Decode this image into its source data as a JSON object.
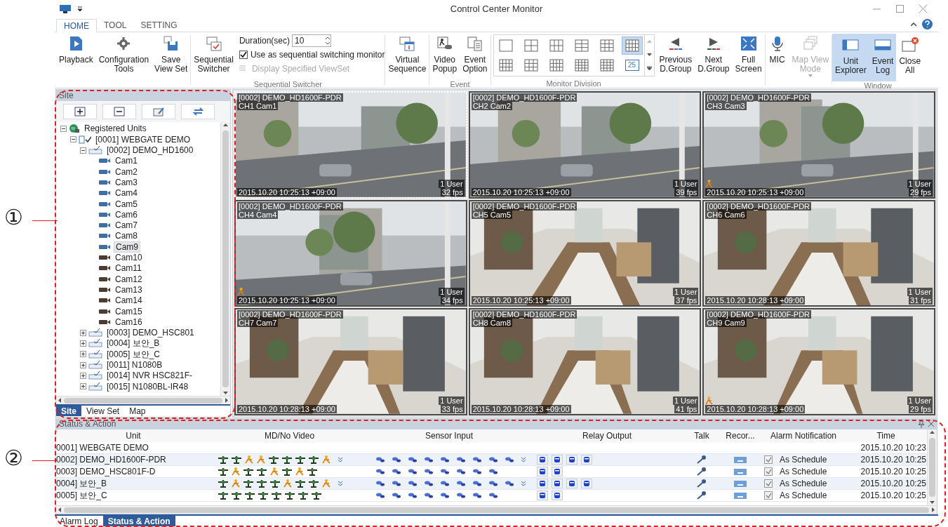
{
  "window": {
    "title": "Control Center Monitor"
  },
  "ribbon": {
    "tabs": [
      {
        "label": "HOME",
        "selected": true
      },
      {
        "label": "TOOL",
        "selected": false
      },
      {
        "label": "SETTING",
        "selected": false
      }
    ],
    "main_buttons": [
      {
        "label": "Playback",
        "kind": "playback"
      },
      {
        "label": "Configuration\nTools",
        "kind": "gear"
      },
      {
        "label": "Save\nView Set",
        "kind": "save"
      }
    ],
    "sequential": {
      "button": "Sequential\nSwitcher",
      "duration_label": "Duration(sec)",
      "duration": "10",
      "checkbox": {
        "label": "Use as sequential switching monitor",
        "checked": true
      },
      "display_viewset": {
        "label": "Display Specified ViewSet",
        "disabled": true
      },
      "group_label": "Sequential Switcher"
    },
    "virtual": {
      "label": "Virtual\nSequence"
    },
    "event": {
      "buttons": [
        {
          "label": "Video\nPopup",
          "kind": "popup"
        },
        {
          "label": "Event\nOption",
          "kind": "option"
        }
      ],
      "group_label": "Event"
    },
    "monitor_division": {
      "group_label": "Monitor Division",
      "layouts": [
        {
          "kind": "single",
          "selected": false
        },
        {
          "kind": "quad",
          "selected": false
        },
        {
          "kind": "six",
          "selected": false
        },
        {
          "kind": "seven",
          "selected": false
        },
        {
          "kind": "eight",
          "selected": false
        },
        {
          "kind": "nine",
          "selected": true
        },
        {
          "kind": "ten",
          "selected": false
        },
        {
          "kind": "twelve",
          "selected": false
        },
        {
          "kind": "thirteen",
          "selected": false
        },
        {
          "kind": "fourteen",
          "selected": false
        },
        {
          "kind": "sixteen",
          "selected": false
        },
        {
          "kind": "number",
          "label": "25",
          "selected": false
        }
      ]
    },
    "nav": [
      {
        "label": "Previous\nD.Group",
        "kind": "prev"
      },
      {
        "label": "Next\nD.Group",
        "kind": "next"
      },
      {
        "label": "Full\nScreen",
        "kind": "full"
      }
    ],
    "mic": {
      "label": "MIC"
    },
    "map_view": {
      "label": "Map View\nMode",
      "disabled": true
    },
    "window_group": {
      "group_label": "Window",
      "buttons": [
        {
          "label": "Unit\nExplorer",
          "kind": "unit",
          "selected": true
        },
        {
          "label": "Event\nLog",
          "kind": "log",
          "selected": true
        },
        {
          "label": "Close\nAll",
          "kind": "close",
          "selected": false
        }
      ]
    }
  },
  "site_panel": {
    "title": "Site",
    "tools": [
      {
        "kind": "add"
      },
      {
        "kind": "remove"
      },
      {
        "kind": "edit"
      },
      {
        "kind": "swap"
      }
    ],
    "tree": [
      {
        "label": "Registered Units",
        "kind": "root",
        "expanded": true,
        "children": [
          {
            "label": "[0001] WEBGATE DEMO",
            "kind": "site",
            "expanded": true,
            "children": [
              {
                "label": "[0002] DEMO_HD1600",
                "kind": "unit",
                "expanded": true,
                "children": [
                  {
                    "label": "Cam1",
                    "kind": "camera",
                    "color": "#3f6fa3",
                    "selected": false
                  },
                  {
                    "label": "Cam2",
                    "kind": "camera",
                    "color": "#3f6fa3",
                    "selected": false
                  },
                  {
                    "label": "Cam3",
                    "kind": "camera",
                    "color": "#3f6fa3",
                    "selected": false
                  },
                  {
                    "label": "Cam4",
                    "kind": "camera",
                    "color": "#3f6fa3",
                    "selected": false
                  },
                  {
                    "label": "Cam5",
                    "kind": "camera",
                    "color": "#3f6fa3",
                    "selected": false
                  },
                  {
                    "label": "Cam6",
                    "kind": "camera",
                    "color": "#3f6fa3",
                    "selected": false
                  },
                  {
                    "label": "Cam7",
                    "kind": "camera",
                    "color": "#3f6fa3",
                    "selected": false
                  },
                  {
                    "label": "Cam8",
                    "kind": "camera",
                    "color": "#3f6fa3",
                    "selected": false
                  },
                  {
                    "label": "Cam9",
                    "kind": "camera",
                    "color": "#3f6fa3",
                    "selected": true
                  },
                  {
                    "label": "Cam10",
                    "kind": "camera",
                    "color": "#4a3c32",
                    "selected": false
                  },
                  {
                    "label": "Cam11",
                    "kind": "camera",
                    "color": "#4a3c32",
                    "selected": false
                  },
                  {
                    "label": "Cam12",
                    "kind": "camera",
                    "color": "#4a3c32",
                    "selected": false
                  },
                  {
                    "label": "Cam13",
                    "kind": "camera",
                    "color": "#4a3c32",
                    "selected": false
                  },
                  {
                    "label": "Cam14",
                    "kind": "camera",
                    "color": "#4a3c32",
                    "selected": false
                  },
                  {
                    "label": "Cam15",
                    "kind": "camera",
                    "color": "#4a3c32",
                    "selected": false
                  },
                  {
                    "label": "Cam16",
                    "kind": "camera",
                    "color": "#4a3c32",
                    "selected": false
                  }
                ]
              },
              {
                "label": "[0003] DEMO_HSC801",
                "kind": "unit",
                "expanded": false
              },
              {
                "label": "[0004] 보안_B",
                "kind": "unit",
                "expanded": false
              },
              {
                "label": "[0005] 보안_C",
                "kind": "unit",
                "expanded": false
              },
              {
                "label": "[0011] N1080B",
                "kind": "unit",
                "expanded": false
              },
              {
                "label": "[0014] NVR HSC821F-",
                "kind": "unit",
                "expanded": false
              },
              {
                "label": "[0015] N1080BL-IR48",
                "kind": "unit",
                "expanded": false
              }
            ]
          }
        ]
      }
    ],
    "tabs": [
      {
        "label": "Site",
        "selected": true
      },
      {
        "label": "View Set",
        "selected": false
      },
      {
        "label": "Map",
        "selected": false
      }
    ]
  },
  "video_tiles": [
    {
      "unit": "[0002] DEMO_HD1600F-PDR",
      "channel": "CH1 Cam1",
      "timestamp": "2015.10.20 10:25:13 +09:00",
      "users": "1 User",
      "fps": "32 fps",
      "motion": false,
      "selected": true
    },
    {
      "unit": "[0002] DEMO_HD1600F-PDR",
      "channel": "CH2 Cam2",
      "timestamp": "2015.10.20 10:25:13 +09:00",
      "users": "1 User",
      "fps": "39 fps",
      "motion": false,
      "selected": false
    },
    {
      "unit": "[0002] DEMO_HD1600F-PDR",
      "channel": "CH3 Cam3",
      "timestamp": "2015.10.20 10:25:13 +09:00",
      "users": "1 User",
      "fps": "29 fps",
      "motion": true,
      "selected": false
    },
    {
      "unit": "[0002] DEMO_HD1600F-PDR",
      "channel": "CH4 Cam4",
      "timestamp": "2015.10.20 10:25:13 +09:00",
      "users": "1 User",
      "fps": "34 fps",
      "motion": true,
      "selected": false
    },
    {
      "unit": "[0002] DEMO_HD1600F-PDR",
      "channel": "CH5 Cam5",
      "timestamp": "2015.10.20 10:25:13 +09:00",
      "users": "1 User",
      "fps": "37 fps",
      "motion": false,
      "selected": false
    },
    {
      "unit": "[0002] DEMO_HD1600F-PDR",
      "channel": "CH6 Cam6",
      "timestamp": "2015.10.20 10:28:13 +09:00",
      "users": "1 User",
      "fps": "31 fps",
      "motion": false,
      "selected": false
    },
    {
      "unit": "[0002] DEMO_HD1600F-PDR",
      "channel": "CH7 Cam7",
      "timestamp": "2015.10.20 10:28:13 +09:00",
      "users": "1 User",
      "fps": "33 fps",
      "motion": false,
      "selected": false
    },
    {
      "unit": "[0002] DEMO_HD1600F-PDR",
      "channel": "CH8 Cam8",
      "timestamp": "2015.10.20 10:28:13 +09:00",
      "users": "1 User",
      "fps": "41 fps",
      "motion": false,
      "selected": false
    },
    {
      "unit": "[0002] DEMO_HD1600F-PDR",
      "channel": "CH9 Cam9",
      "timestamp": "2015.10.20 10:28:13 +09:00",
      "users": "1 User",
      "fps": "29 fps",
      "motion": true,
      "selected": false
    }
  ],
  "status_panel": {
    "title": "Status & Action",
    "columns": [
      "Unit",
      "MD/No Video",
      "Sensor Input",
      "Relay Output",
      "Talk",
      "Recor...",
      "Alarm Notification",
      "Time"
    ],
    "rows": [
      {
        "kind": "site",
        "unit": "0001] WEBGATE DEMO",
        "time": "2015.10.20 10:23"
      },
      {
        "kind": "unit",
        "unit": "0002] DEMO_HD1600F-PDR",
        "md": [
          {
            "motion": false
          },
          {
            "motion": false
          },
          {
            "motion": true
          },
          {
            "motion": true
          },
          {
            "motion": false
          },
          {
            "motion": false
          },
          {
            "motion": false
          },
          {
            "motion": false
          },
          {
            "motion": true
          }
        ],
        "md_more": true,
        "sensors": [
          {
            "kind": "sensor"
          },
          {
            "kind": "sensor"
          },
          {
            "kind": "sensor"
          },
          {
            "kind": "sensor"
          },
          {
            "kind": "sensor"
          },
          {
            "kind": "sensor"
          },
          {
            "kind": "sensor"
          },
          {
            "kind": "sensor"
          },
          {
            "kind": "sensor"
          }
        ],
        "sensors_more": true,
        "relays": [
          {
            "kind": "relay"
          },
          {
            "kind": "relay"
          },
          {
            "kind": "relay"
          },
          {
            "kind": "relay"
          }
        ],
        "alarm": {
          "checked": true,
          "label": "As Schedule"
        },
        "time": "2015.10.20 10:25"
      },
      {
        "kind": "unit",
        "unit": "0003] DEMO_HSC801F-D",
        "md": [
          {
            "motion": false
          },
          {
            "motion": true
          },
          {
            "motion": false
          },
          {
            "motion": false
          },
          {
            "motion": true
          },
          {
            "motion": false
          },
          {
            "motion": true
          },
          {
            "motion": false
          }
        ],
        "md_more": false,
        "sensors": [
          {
            "kind": "sensor"
          },
          {
            "kind": "sensor"
          },
          {
            "kind": "sensor"
          },
          {
            "kind": "sensor"
          },
          {
            "kind": "sensor"
          },
          {
            "kind": "sensor"
          },
          {
            "kind": "sensor"
          },
          {
            "kind": "sensor"
          }
        ],
        "sensors_more": false,
        "relays": [
          {
            "kind": "relay"
          },
          {
            "kind": "relay"
          }
        ],
        "alarm": {
          "checked": true,
          "label": "As Schedule"
        },
        "time": "2015.10.20 10:25"
      },
      {
        "kind": "unit",
        "unit": "0004] 보안_B",
        "md": [
          {
            "motion": false
          },
          {
            "motion": true
          },
          {
            "motion": false
          },
          {
            "motion": false
          },
          {
            "motion": false
          },
          {
            "motion": true
          },
          {
            "motion": false
          },
          {
            "motion": false
          },
          {
            "motion": true
          }
        ],
        "md_more": true,
        "sensors": [
          {
            "kind": "sensor"
          },
          {
            "kind": "sensor"
          },
          {
            "kind": "sensor"
          },
          {
            "kind": "sensor"
          },
          {
            "kind": "sensor"
          },
          {
            "kind": "sensor"
          },
          {
            "kind": "sensor"
          },
          {
            "kind": "sensor"
          },
          {
            "kind": "sensor"
          }
        ],
        "sensors_more": true,
        "relays": [
          {
            "kind": "relay"
          },
          {
            "kind": "relay"
          },
          {
            "kind": "relay"
          },
          {
            "kind": "relay"
          }
        ],
        "alarm": {
          "checked": true,
          "label": "As Schedule"
        },
        "time": "2015.10.20 10:25"
      },
      {
        "kind": "unit",
        "unit": "0005] 보안_C",
        "md": [
          {
            "motion": false
          },
          {
            "motion": false
          },
          {
            "motion": false
          },
          {
            "motion": false
          },
          {
            "motion": false
          },
          {
            "motion": false
          },
          {
            "motion": false
          },
          {
            "motion": false
          }
        ],
        "md_more": false,
        "sensors": [
          {
            "kind": "sensor"
          },
          {
            "kind": "sensor"
          },
          {
            "kind": "sensor"
          },
          {
            "kind": "sensor"
          },
          {
            "kind": "sensor"
          },
          {
            "kind": "sensor"
          },
          {
            "kind": "sensor"
          },
          {
            "kind": "sensor"
          }
        ],
        "sensors_more": false,
        "relays": [
          {
            "kind": "relay"
          },
          {
            "kind": "relay"
          }
        ],
        "alarm": {
          "checked": true,
          "label": "As Schedule"
        },
        "time": "2015.10.20 10:25"
      }
    ],
    "tabs": [
      {
        "label": "Alarm Log",
        "selected": false
      },
      {
        "label": "Status & Action",
        "selected": true
      }
    ]
  },
  "callouts": [
    {
      "label": "①"
    },
    {
      "label": "②"
    }
  ]
}
